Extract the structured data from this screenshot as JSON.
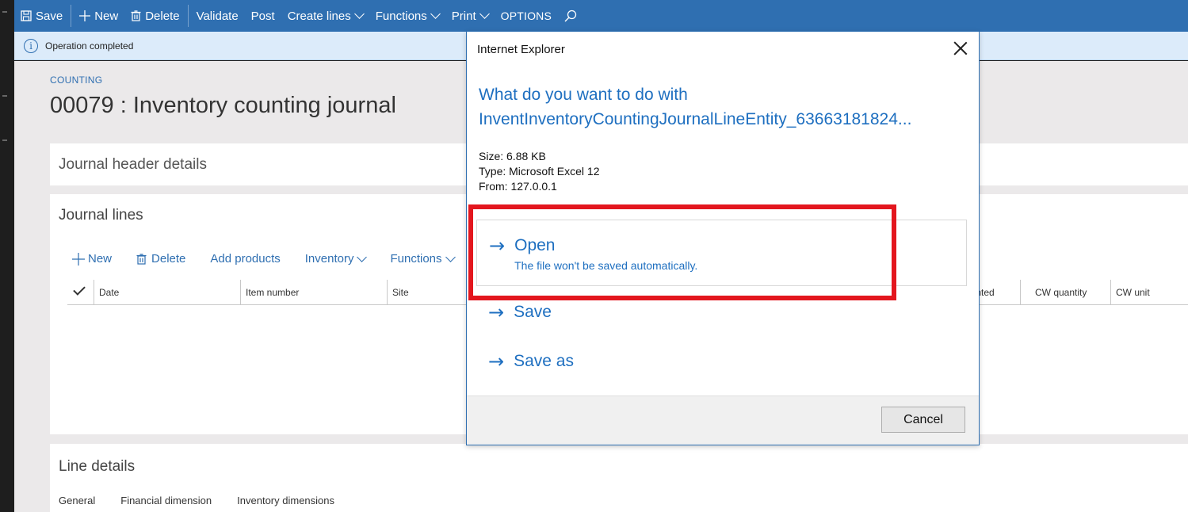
{
  "actionbar": {
    "save": "Save",
    "new": "New",
    "delete": "Delete",
    "validate": "Validate",
    "post": "Post",
    "create_lines": "Create lines",
    "functions": "Functions",
    "print": "Print",
    "options": "OPTIONS"
  },
  "message": {
    "text": "Operation completed"
  },
  "page": {
    "breadcrumb": "COUNTING",
    "title": "00079 : Inventory counting journal"
  },
  "header_details": {
    "label": "Journal header details"
  },
  "journal_lines": {
    "label": "Journal lines",
    "toolbar": {
      "new": "New",
      "delete": "Delete",
      "add_products": "Add products",
      "inventory": "Inventory",
      "functions": "Functions"
    },
    "columns": {
      "date": "Date",
      "item_number": "Item number",
      "site": "Site",
      "counted_partial": "ounted",
      "cw_quantity": "CW quantity",
      "cw_unit": "CW unit"
    }
  },
  "line_details": {
    "label": "Line details",
    "tabs": [
      "General",
      "Financial dimension",
      "Inventory dimensions"
    ]
  },
  "dialog": {
    "title": "Internet Explorer",
    "question_line1": "What do you want to do with",
    "question_line2": "InventInventoryCountingJournalLineEntity_63663181824...",
    "size": "Size: 6.88 KB",
    "type": "Type: Microsoft Excel 12",
    "from": "From: 127.0.0.1",
    "open_label": "Open",
    "open_sub": "The file won't be saved automatically.",
    "save_label": "Save",
    "save_as_label": "Save as",
    "cancel": "Cancel"
  },
  "colors": {
    "action_bar": "#2f6fb1",
    "message_bar": "#dcebfa",
    "dialog_link": "#1e6fc0",
    "highlight": "#e3161e"
  }
}
